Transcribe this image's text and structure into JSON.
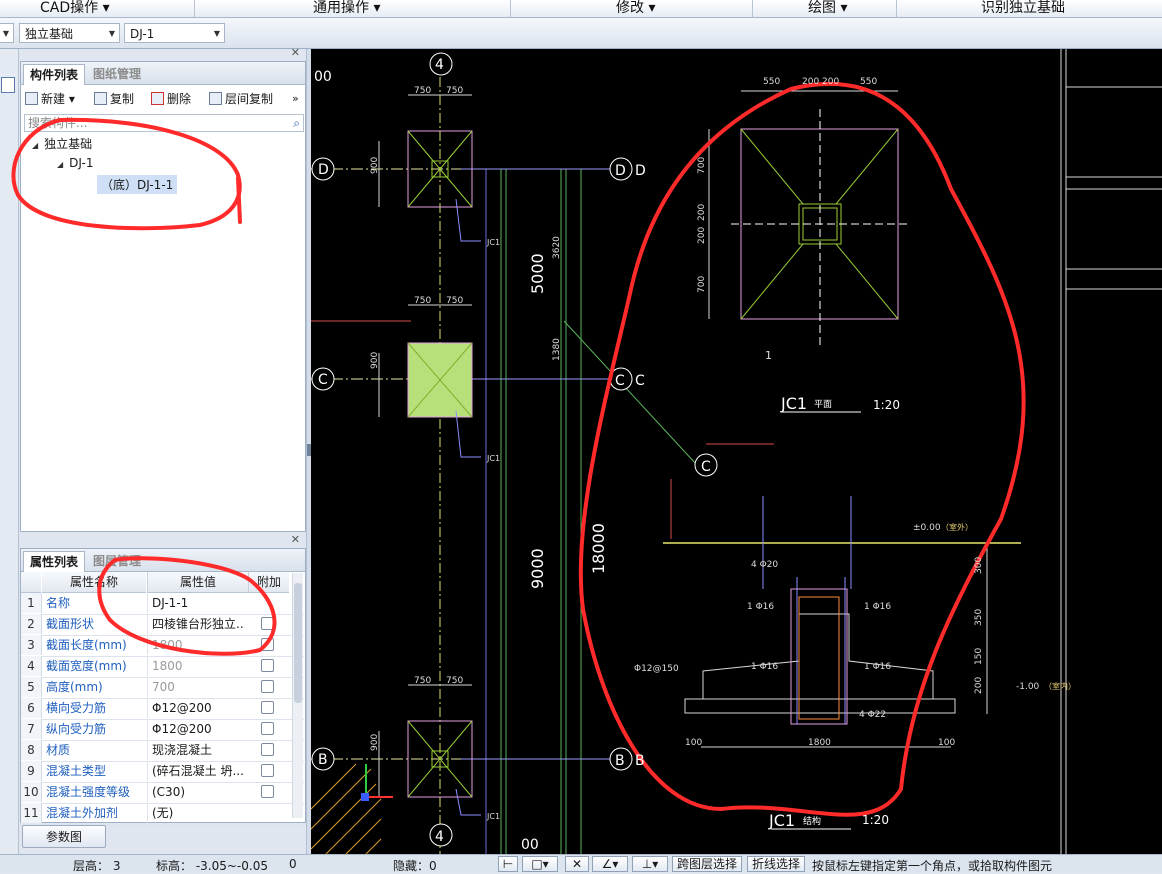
{
  "menubar": {
    "items": [
      "CAD操作 ▾",
      "通用操作 ▾",
      "修改 ▾",
      "绘图 ▾",
      "识别独立基础"
    ]
  },
  "toolbar": {
    "category_combo": "独立基础",
    "component_combo": "DJ-1"
  },
  "component_panel": {
    "tabs": [
      "构件列表",
      "图纸管理"
    ],
    "buttons": [
      "新建",
      "复制",
      "删除",
      "层间复制"
    ],
    "more": "»",
    "search_placeholder": "搜索构件...",
    "tree": {
      "root": "独立基础",
      "child": "DJ-1",
      "leaf": "（底）DJ-1-1"
    }
  },
  "property_panel": {
    "tabs": [
      "属性列表",
      "图层管理"
    ],
    "headers": [
      "属性名称",
      "属性值",
      "附加"
    ],
    "rows": [
      {
        "n": "1",
        "name": "名称",
        "value": "DJ-1-1",
        "gray": false,
        "check": false
      },
      {
        "n": "2",
        "name": "截面形状",
        "value": "四棱锥台形独立...",
        "gray": false,
        "check": true
      },
      {
        "n": "3",
        "name": "截面长度(mm)",
        "value": "1800",
        "gray": true,
        "check": true
      },
      {
        "n": "4",
        "name": "截面宽度(mm)",
        "value": "1800",
        "gray": true,
        "check": true
      },
      {
        "n": "5",
        "name": "高度(mm)",
        "value": "700",
        "gray": true,
        "check": true
      },
      {
        "n": "6",
        "name": "横向受力筋",
        "value": "Φ12@200",
        "gray": false,
        "check": true
      },
      {
        "n": "7",
        "name": "纵向受力筋",
        "value": "Φ12@200",
        "gray": false,
        "check": true
      },
      {
        "n": "8",
        "name": "材质",
        "value": "现浇混凝土",
        "gray": false,
        "check": true
      },
      {
        "n": "9",
        "name": "混凝土类型",
        "value": "(碎石混凝土 坍...",
        "gray": false,
        "check": true
      },
      {
        "n": "10",
        "name": "混凝土强度等级",
        "value": "(C30)",
        "gray": false,
        "check": true
      },
      {
        "n": "11",
        "name": "混凝土外加剂",
        "value": "(无)",
        "gray": false,
        "check": false
      }
    ],
    "param_button": "参数图"
  },
  "statusbar": {
    "floor_height": "层高： 3",
    "elevation": "标高： -3.05~-0.05",
    "zero": "0",
    "hidden": "隐藏：0",
    "cross_layer": "跨图层选择",
    "polyline_select": "折线选择",
    "hint": "按鼠标左键指定第一个角点，或拾取构件图元"
  },
  "cad": {
    "axis_4": "4",
    "axis_D": "D",
    "axis_C": "C",
    "axis_B": "B",
    "corner_00": "00",
    "corner_00b": "00",
    "dim_750": "750",
    "dim_900": "900",
    "dim_5000": "5000",
    "dim_9000": "9000",
    "dim_18000": "18000",
    "dim_3620": "3620",
    "dim_1380": "1380",
    "label_jc1": "JC1",
    "plan_title": "JC1",
    "plan_sub": "平面",
    "plan_scale": "1:20",
    "section_title": "JC1",
    "section_sub": "结构",
    "section_scale": "1:20",
    "plan_dims_top": [
      "550",
      "200",
      "200",
      "550"
    ],
    "plan_dims_left": [
      "700",
      "200",
      "200",
      "700"
    ],
    "plan_one": "1",
    "elev_top": "±0.00",
    "elev_top_note": "（室外）",
    "elev_bot": "-1.00",
    "elev_bot_note": "（室内）",
    "rebar_420": "4 Φ20",
    "rebar_116": "1 Φ16",
    "rebar_422": "4 Φ22",
    "rebar_12150": "Φ12@150",
    "sec_dims_bottom": [
      "100",
      "1800",
      "100"
    ],
    "sec_dims_right": [
      "300",
      "350",
      "150",
      "200"
    ]
  },
  "colors": {
    "annotation_red": "#ff2a2a",
    "cad_bg": "#000000",
    "cad_green": "#9acd32",
    "cad_white": "#ffffff"
  }
}
